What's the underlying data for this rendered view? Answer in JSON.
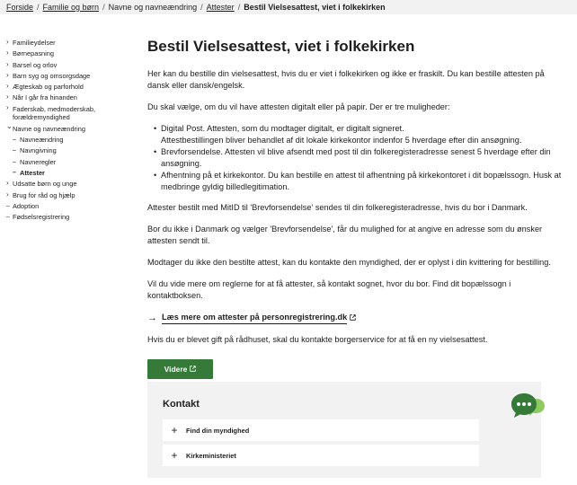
{
  "breadcrumb": {
    "items": [
      "Forside",
      "Familie og børn",
      "Navne og navneændring",
      "Attester"
    ],
    "current": "Bestil Vielsesattest, viet i folkekirken"
  },
  "sidebar": {
    "items": [
      {
        "label": "Familieydelser"
      },
      {
        "label": "Børnepasning"
      },
      {
        "label": "Barsel og orlov"
      },
      {
        "label": "Barn syg og omsorgsdage"
      },
      {
        "label": "Ægteskab og parforhold"
      },
      {
        "label": "Når I går fra hinanden"
      },
      {
        "label": "Faderskab, medmoderskab, forældremyndighed"
      },
      {
        "label": "Navne og navneændring"
      },
      {
        "label": "Navneændring"
      },
      {
        "label": "Navngivning"
      },
      {
        "label": "Navneregler"
      },
      {
        "label": "Attester"
      },
      {
        "label": "Udsatte børn og unge"
      },
      {
        "label": "Brug for råd og hjælp"
      },
      {
        "label": "Adoption"
      },
      {
        "label": "Fødselsregistrering"
      }
    ]
  },
  "main": {
    "title": "Bestil Vielsesattest, viet i folkekirken",
    "intro": "Her kan du bestille din vielsesattest, hvis du er viet i folkekirken og ikke er fraskilt. Du kan bestille attesten på dansk eller dansk/engelsk.",
    "options_intro": "Du skal vælge, om du vil have attesten digitalt eller på papir. Der er tre muligheder:",
    "options": [
      "Digital Post. Attesten, som du modtager digitalt, er digitalt signeret.",
      "Attestbestillingen bliver behandlet af dit lokale kirkekontor indenfor 5 hverdage efter din ansøgning.",
      "Brevforsendelse. Attesten vil blive afsendt med post til din folkeregisteradresse senest 5 hverdage efter din ansøgning.",
      "Afhentning på et kirkekontor. Du kan bestille en attest til afhentning på kirkekontoret i dit bopælssogn. Husk at medbringe gyldig billedlegitimation."
    ],
    "para1": "Attester bestilt med MitID til 'Brevforsendelse' sendes til din folkeregisteradresse, hvis du bor i Danmark.",
    "para2": "Bor du ikke i Danmark og vælger 'Brevforsendelse', får du mulighed for at angive en adresse som du ønsker attesten sendt til.",
    "para3": "Modtager du ikke den bestilte attest, kan du kontakte den myndighed, der er oplyst i din kvittering for bestilling.",
    "para4": "Vil du vide mere om reglerne for at få attester, så kontakt sognet, hvor du bor. Find dit bopælssogn i kontaktboksen.",
    "readmore_label": "Læs mere om attester på personregistrering.dk",
    "para5": "Hvis du er blevet gift på rådhuset, skal du kontakte borgerservice for at få en ny vielsesattest.",
    "button_label": "Videre"
  },
  "contact": {
    "title": "Kontakt",
    "items": [
      {
        "label": "Find din myndighed"
      },
      {
        "label": "Kirkeministeriet"
      }
    ]
  },
  "colors": {
    "primary_button": "#357a38",
    "chat_bubble": "#357a38",
    "chat_bubble_light": "#8fca5e",
    "contact_background": "#f2f2f2",
    "breadcrumb_background": "#f2f2f2"
  },
  "icons": {
    "sidebar_chevron": "chevron-right-icon",
    "readmore": "arrow-right-icon",
    "external": "external-link-icon",
    "expand": "plus-icon",
    "chat": "chat-bubbles-icon"
  }
}
